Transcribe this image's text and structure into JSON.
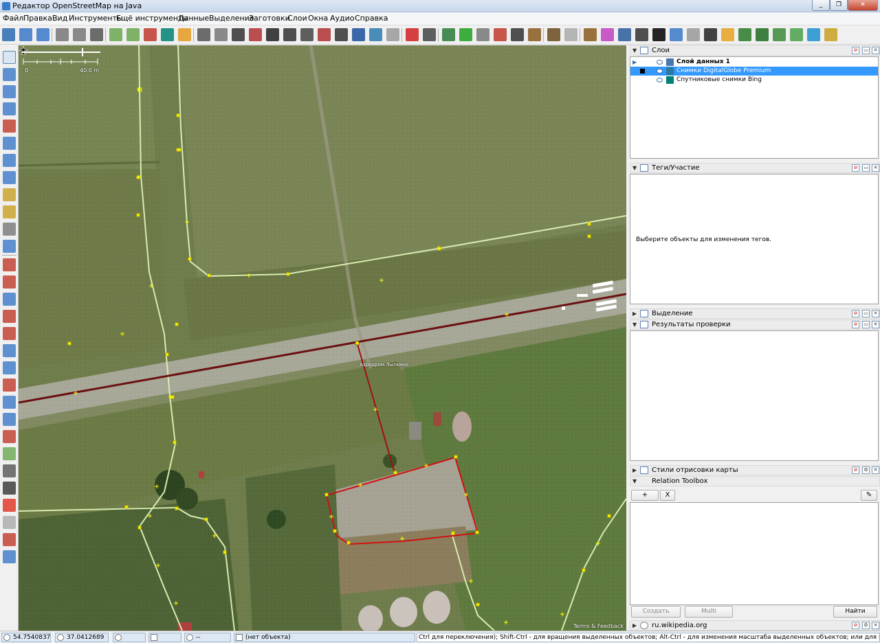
{
  "window": {
    "title": "Редактор OpenStreetMap на Java"
  },
  "menu": [
    "Файл",
    "Правка",
    "Вид",
    "Инструменты",
    "Ещё инструменты",
    "Данные",
    "Выделение",
    "Заготовки",
    "Слои",
    "Окна",
    "Аудио",
    "Справка"
  ],
  "toolbar_icons": [
    "open-icon",
    "download-icon",
    "upload-icon",
    "undo-icon",
    "redo-icon",
    "preferences-icon",
    "wms-icon",
    "imagery-icon",
    "edit-icon",
    "bing-icon",
    "highway-icon",
    "road-icon",
    "track-icon",
    "traffic-light-icon",
    "building-icon",
    "railway-icon",
    "barrier-icon",
    "grid-icon",
    "wall-icon",
    "car-icon",
    "info-icon",
    "globe-icon",
    "gray-circle-icon",
    "russia-flag-icon",
    "theatre-icon",
    "picture-icon",
    "hospital-icon",
    "school-icon",
    "balloons-icon",
    "phone-icon",
    "castle-icon",
    "factory-icon",
    "house-icon",
    "restaurant-icon",
    "cart-icon",
    "shirt-icon",
    "monitor-icon",
    "dollar-icon",
    "poi-icon",
    "paperclip-icon",
    "person-icon",
    "bag-icon",
    "tree-icon",
    "forest-icon",
    "plant-icon",
    "grass-icon",
    "water-icon",
    "field-icon"
  ],
  "left_tools": [
    "select-icon",
    "lasso-icon",
    "draw-icon",
    "zoom-icon",
    "delete-icon",
    "split-icon",
    "combine-icon",
    "align-icon",
    "draw-pencil-icon",
    "edit-pencil-icon",
    "building-tool-icon",
    "more-tools-icon",
    "layers-toggle-icon",
    "tags-toggle-icon",
    "selection-toggle-icon",
    "commands-toggle-icon",
    "conflict-toggle-icon",
    "filter-toggle-icon",
    "validation-toggle-icon",
    "styles-toggle-icon",
    "history-toggle-icon",
    "imagery-toggle-icon",
    "pin-icon",
    "measure-icon",
    "route-icon",
    "shortcut-icon",
    "statistics-icon",
    "globe-tool-icon",
    "barcode-icon",
    "expand-icon"
  ],
  "map": {
    "scale_zero": "0",
    "scale_distance": "40.0 m",
    "aerodrome_label": "Аэродром Лыткино",
    "attribution": "Terms & Feedback"
  },
  "layers_panel": {
    "title": "Слои",
    "layers": [
      {
        "name": "Слой данных 1",
        "active": true,
        "selected": false
      },
      {
        "name": "Снимки DigitalGlobe Premium",
        "active": false,
        "selected": true
      },
      {
        "name": "Спутниковые снимки Bing",
        "active": false,
        "selected": false
      }
    ]
  },
  "tags_panel": {
    "title": "Теги/Участие",
    "message": "Выберите объекты для изменения тегов."
  },
  "selection_panel": {
    "title": "Выделение"
  },
  "validation_panel": {
    "title": "Результаты проверки"
  },
  "styles_panel": {
    "title": "Стили отрисовки карты"
  },
  "relation_panel": {
    "title": "Relation Toolbox",
    "add_label": "+",
    "remove_label": "X",
    "create_label": "Создать",
    "multi_label": "Multi",
    "find_label": "Найти"
  },
  "wiki_panel": {
    "title": "ru.wikipedia.org"
  },
  "status": {
    "lat": "54.7540837",
    "lon": "37.0412689",
    "heading": "",
    "angle": "",
    "distance": "--",
    "object": "(нет объекта)",
    "help": "Ctrl для переключения); Shift-Ctrl - для вращения выделенных объектов; Alt-Ctrl - для изменения масштаба выделенных объектов; или для изменения выделения"
  },
  "colors": {
    "accent": "#3399ff",
    "selected_way": "#c00000",
    "highway": "#d8ecb0",
    "runway": "#6b0f0f"
  }
}
